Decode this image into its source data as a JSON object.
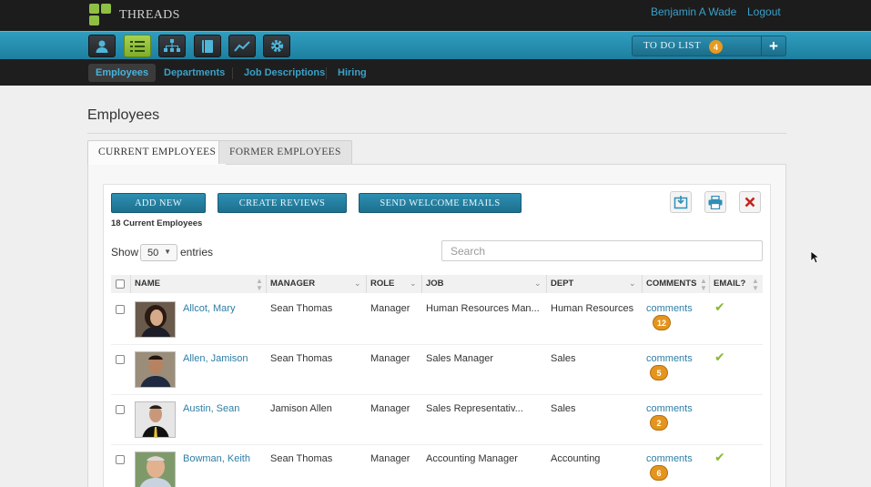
{
  "app": {
    "brand": "THREADS"
  },
  "header": {
    "user": "Benjamin A Wade",
    "logout": "Logout"
  },
  "toolbar": {
    "icons": [
      "user-icon",
      "list-icon",
      "org-chart-icon",
      "book-icon",
      "chart-icon",
      "gear-icon"
    ],
    "todo_label": "TO DO LIST",
    "todo_count": "4",
    "todo_add": "+"
  },
  "subnav": {
    "items": [
      "Employees",
      "Departments",
      "Job Descriptions",
      "Hiring"
    ]
  },
  "page": {
    "title": "Employees"
  },
  "tabs": [
    "CURRENT EMPLOYEES",
    "FORMER EMPLOYEES"
  ],
  "actions": {
    "add_new": "ADD NEW",
    "create_reviews": "CREATE REVIEWS",
    "send_welcome": "SEND WELCOME EMAILS",
    "icons": [
      "export-icon",
      "print-icon",
      "delete-icon"
    ]
  },
  "summary": {
    "count_text": "18 Current Employees"
  },
  "paging": {
    "show": "Show",
    "entries": "entries",
    "value": "50"
  },
  "search": {
    "placeholder": "Search"
  },
  "table": {
    "columns": [
      "NAME",
      "MANAGER",
      "ROLE",
      "JOB",
      "DEPT",
      "COMMENTS",
      "EMAIL?"
    ],
    "rows": [
      {
        "name": "Allcot, Mary",
        "manager": "Sean Thomas",
        "role": "Manager",
        "job": "Human Resources Man...",
        "dept": "Human Resources",
        "comments": "comments",
        "count": "12",
        "email": "✔"
      },
      {
        "name": "Allen, Jamison",
        "manager": "Sean Thomas",
        "role": "Manager",
        "job": "Sales Manager",
        "dept": "Sales",
        "comments": "comments",
        "count": "5",
        "email": "✔"
      },
      {
        "name": "Austin, Sean",
        "manager": "Jamison Allen",
        "role": "Manager",
        "job": "Sales Representativ...",
        "dept": "Sales",
        "comments": "comments",
        "count": "2",
        "email": ""
      },
      {
        "name": "Bowman, Keith",
        "manager": "Sean Thomas",
        "role": "Manager",
        "job": "Accounting Manager",
        "dept": "Accounting",
        "comments": "comments",
        "count": "6",
        "email": "✔"
      }
    ]
  },
  "colors": {
    "accent": "#2f9ec0",
    "active_green": "#8fc044",
    "badge": "#e4951f",
    "link": "#2f7ea4"
  }
}
